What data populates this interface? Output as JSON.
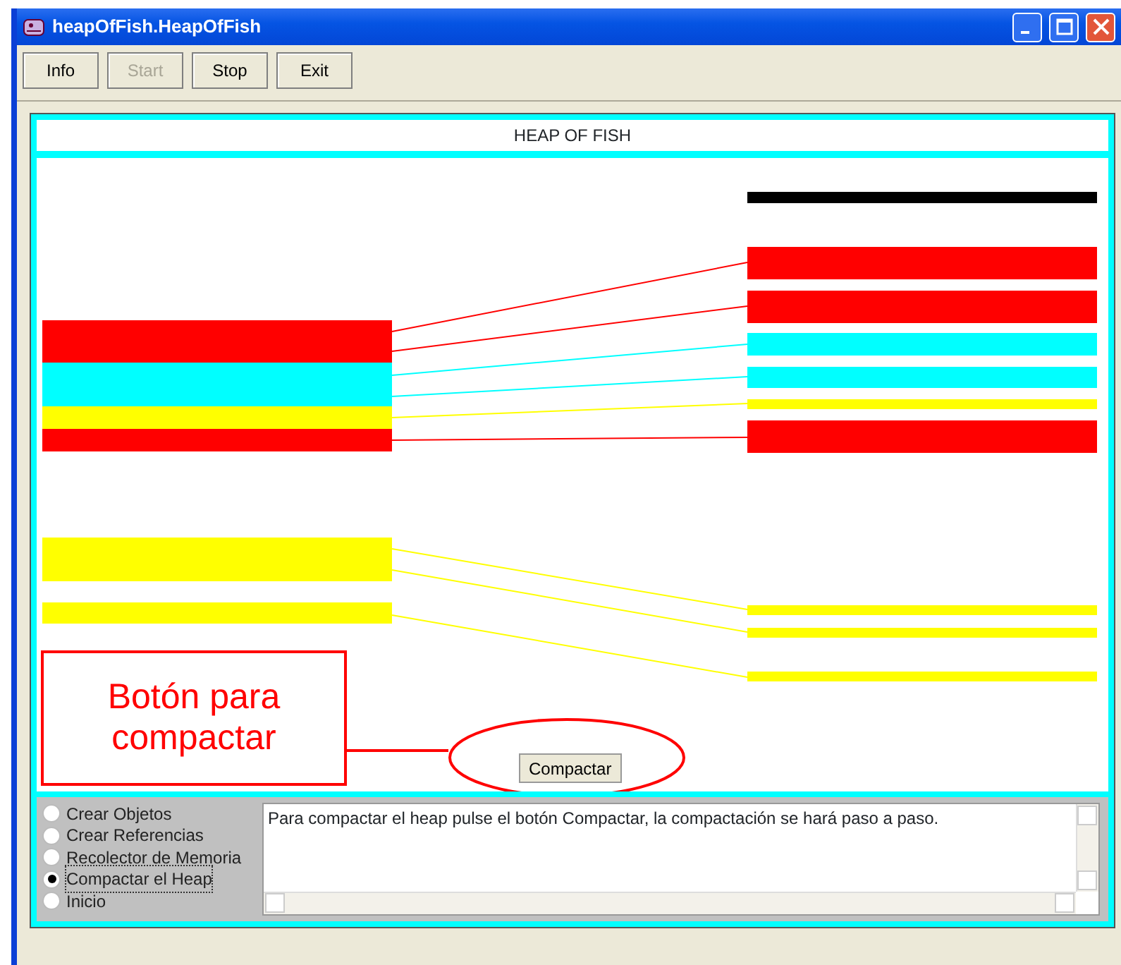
{
  "window": {
    "title": "heapOfFish.HeapOfFish"
  },
  "toolbar": [
    {
      "label": "Info",
      "disabled": false
    },
    {
      "label": "Start",
      "disabled": true
    },
    {
      "label": "Stop",
      "disabled": false
    },
    {
      "label": "Exit",
      "disabled": false
    }
  ],
  "panel_title": "HEAP OF FISH",
  "heap": {
    "left_blocks": [
      {
        "color": "#ff0000"
      },
      {
        "color": "#00ffff"
      },
      {
        "color": "#ffff00"
      },
      {
        "color": "#ff0000"
      },
      {
        "color": "#ffff00"
      },
      {
        "color": "#ffff00"
      }
    ],
    "right_blocks": [
      {
        "color": "#000000"
      },
      {
        "color": "#ff0000"
      },
      {
        "color": "#ff0000"
      },
      {
        "color": "#00ffff"
      },
      {
        "color": "#00ffff"
      },
      {
        "color": "#ffff00"
      },
      {
        "color": "#ff0000"
      },
      {
        "color": "#ffff00"
      },
      {
        "color": "#ffff00"
      },
      {
        "color": "#ffff00"
      }
    ],
    "links": [
      {
        "color": "#ff0000"
      },
      {
        "color": "#ff0000"
      },
      {
        "color": "#00ffff"
      },
      {
        "color": "#00ffff"
      },
      {
        "color": "#ffff00"
      },
      {
        "color": "#ff0000"
      },
      {
        "color": "#ffff00"
      },
      {
        "color": "#ffff00"
      },
      {
        "color": "#ffff00"
      }
    ]
  },
  "annotation": "Botón para compactar",
  "compact_button": "Compactar",
  "modes": [
    {
      "label": "Crear Objetos",
      "selected": false
    },
    {
      "label": "Crear Referencias",
      "selected": false
    },
    {
      "label": "Recolector de Memoria",
      "selected": false
    },
    {
      "label": "Compactar el Heap",
      "selected": true
    },
    {
      "label": "Inicio",
      "selected": false
    }
  ],
  "message": "Para compactar el heap pulse el botón Compactar, la compactación se hará paso a paso."
}
